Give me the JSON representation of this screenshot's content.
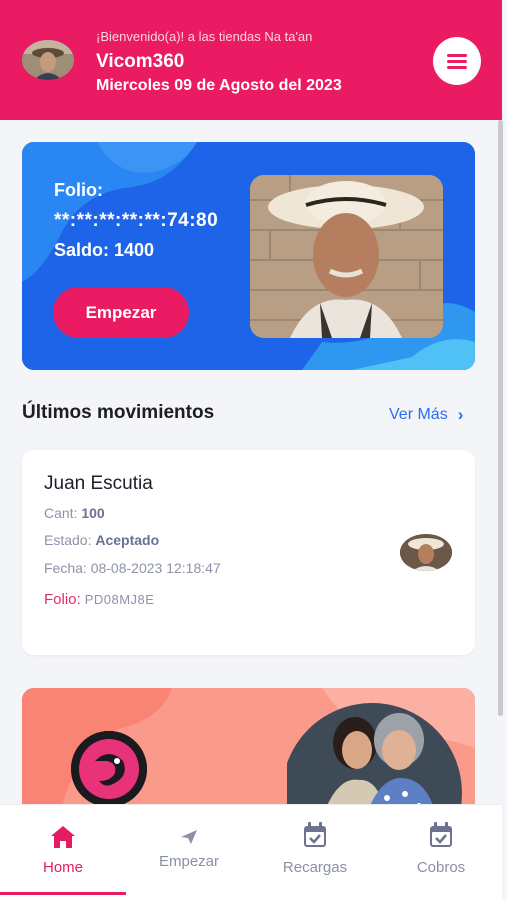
{
  "header": {
    "welcome": "¡Bienvenido(a)! a las tiendas Na ta'an",
    "user_name": "Vicom360",
    "date": "Miercoles 09 de Agosto del 2023"
  },
  "hero": {
    "folio_label": "Folio:",
    "folio_value": "**:**:**:**:**:74:80",
    "saldo": "Saldo: 1400",
    "start_button": "Empezar"
  },
  "movements": {
    "title": "Últimos movimientos",
    "see_more": "Ver Más",
    "items": [
      {
        "name": "Juan Escutia",
        "cant_label": "Cant:",
        "cant_value": "100",
        "estado_label": "Estado:",
        "estado_value": "Aceptado",
        "fecha": "Fecha: 08-08-2023 12:18:47",
        "folio_label": "Folio:",
        "folio_value": "PD08MJ8E"
      }
    ]
  },
  "nav": {
    "items": [
      {
        "label": "Home",
        "icon": "home-icon",
        "active": true
      },
      {
        "label": "Empezar",
        "icon": "send-icon",
        "active": false
      },
      {
        "label": "Recargas",
        "icon": "calendar-check-icon",
        "active": false
      },
      {
        "label": "Cobros",
        "icon": "calendar-check-icon",
        "active": false
      }
    ]
  },
  "colors": {
    "brand_pink": "#ea1b63",
    "hero_blue": "#1e64e8",
    "link_blue": "#2a6df0",
    "promo_salmon": "#fa9d8e"
  }
}
